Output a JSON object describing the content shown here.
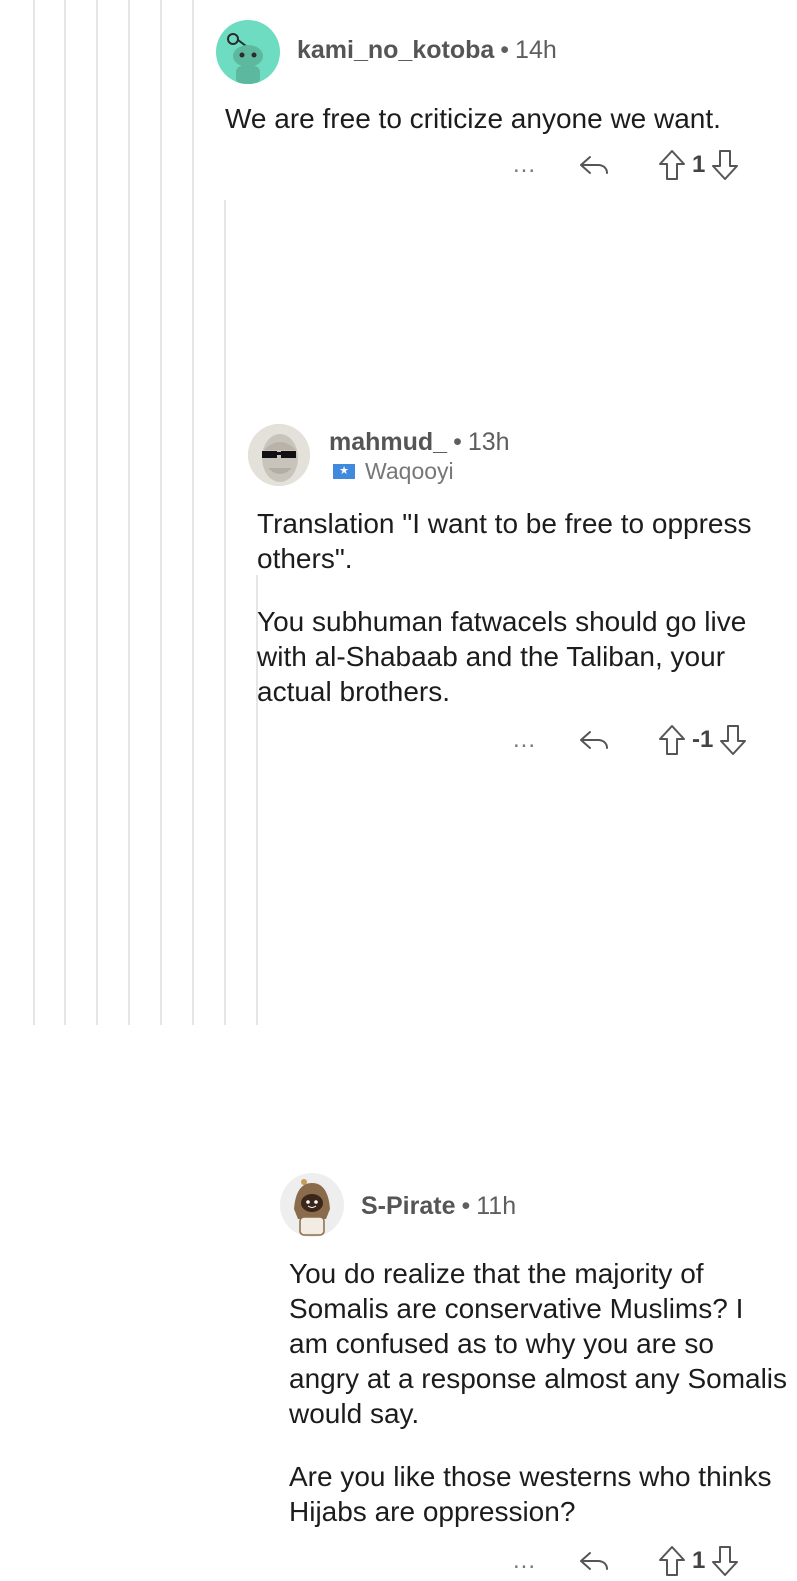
{
  "comments": [
    {
      "username": "kami_no_kotoba",
      "age": "14h",
      "flair": "",
      "paragraphs": [
        "We are free to criticize anyone we want."
      ],
      "score": "1",
      "more_label": "..."
    },
    {
      "username": "mahmud_",
      "age": "13h",
      "flair": "Waqooyi",
      "paragraphs": [
        "Translation \"I want to be free to oppress others\".",
        "You subhuman fatwacels should go live with al-Shabaab and the Taliban, your actual brothers."
      ],
      "score": "-1",
      "more_label": "..."
    },
    {
      "username": "S-Pirate",
      "age": "11h",
      "flair": "",
      "paragraphs": [
        "You do realize that the majority of Somalis are conservative Muslims? I am confused as to why you are so angry at a response almost any Somalis would say.",
        "Are you like those westerns who thinks Hijabs are oppression?"
      ],
      "score": "1",
      "more_label": "..."
    }
  ],
  "icons": {
    "reply": "reply-arrow-icon",
    "upvote": "upvote-arrow-icon",
    "downvote": "downvote-arrow-icon",
    "more": "more-options-icon",
    "flag": "somaliland-flag-icon"
  },
  "colors": {
    "avatar_teal": "#6ddcc0",
    "thread_line": "#e6e6e6",
    "meta_text": "#5e5e5e"
  }
}
